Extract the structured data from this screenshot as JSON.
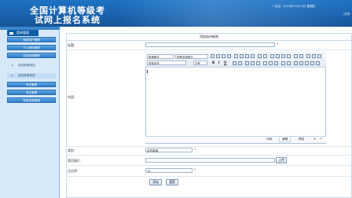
{
  "header": {
    "title_line1": "全国计算机等级考",
    "title_line2": "试网上报名系统",
    "top_info": "☆ 欢迎，2014年11月13日 星期四",
    "top_right": "注销"
  },
  "sidebar": {
    "head_label": "菜单管理",
    "items": [
      {
        "label": "系统用户管理",
        "type": "main"
      },
      {
        "label": "个人资料管理",
        "type": "main"
      },
      {
        "label": "站内新闻管理",
        "type": "main"
      },
      {
        "label": "站内新闻添加",
        "type": "sub"
      },
      {
        "label": "站内新闻查询",
        "type": "sub",
        "active": true
      },
      {
        "label": "考试管理",
        "type": "main"
      },
      {
        "label": "考生管理",
        "type": "main"
      },
      {
        "label": "系统信息管理",
        "type": "main"
      }
    ]
  },
  "form": {
    "title": "添加站内新闻",
    "label_title": "标题:",
    "label_content": "内容:",
    "label_category": "类别:",
    "category_value": "站内新闻",
    "label_image": "首页图片:",
    "upload_label": "上传",
    "label_clicks": "点击率:",
    "clicks_value": "10",
    "required_mark": "*",
    "submit_label": "添加",
    "reset_label": "重置"
  },
  "editor": {
    "paragraph_format": "段落格式",
    "font_format": "特殊字体格式",
    "font_family": "选择字体",
    "font_size": "字号",
    "mode_tabs": [
      "代码",
      "编辑",
      "预览"
    ],
    "expand_label": "+",
    "shrink_label": "−"
  },
  "colors": {
    "banner": "#1a63ae",
    "sidebar_bg": "#d7e9f8",
    "menu_button": "#2f7dc8",
    "required": "#cc0000"
  }
}
